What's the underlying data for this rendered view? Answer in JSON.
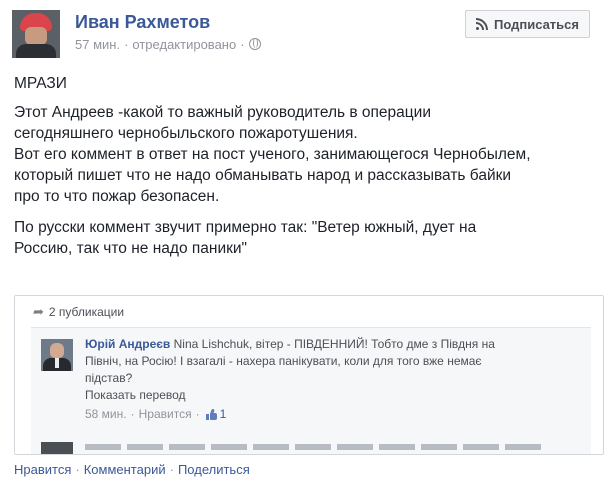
{
  "post": {
    "author_name": "Иван Рахметов",
    "time": "57 мин.",
    "edited": "отредактировано",
    "subscribe_label": "Подписаться",
    "title": "МРАЗИ",
    "paragraph1": "Этот Андреев -какой то важный руководитель в операции\nсегодняшнего чернобыльского пожаротушения.\nВот его коммент в ответ на пост ученого, занимающегося Чернобылем,\nкоторый пишет что не надо обманывать народ и рассказывать байки\nпро то что пожар безопасен.",
    "paragraph2": "По русски коммент звучит примерно так: \"Ветер южный, дует на\nРоссию, так что не надо паники\""
  },
  "shared": {
    "shares_label": "2 публикации",
    "comment": {
      "author": "Юрій Андреєв",
      "text": "Nina Lishchuk, вітер - ПІВДЕННИЙ! Тобто дме з Півдня на\nПівніч, на Росію! І взагалі - нахера панікувати, коли для того вже немає\nпідстав?",
      "translate": "Показать перевод",
      "time": "58 мин.",
      "like_label": "Нравится",
      "likes_count": "1"
    }
  },
  "footer": {
    "like": "Нравится",
    "comment": "Комментарий",
    "share": "Поделиться"
  },
  "colors": {
    "link": "#3b5998",
    "meta": "#90949c",
    "text": "#1d2129"
  }
}
